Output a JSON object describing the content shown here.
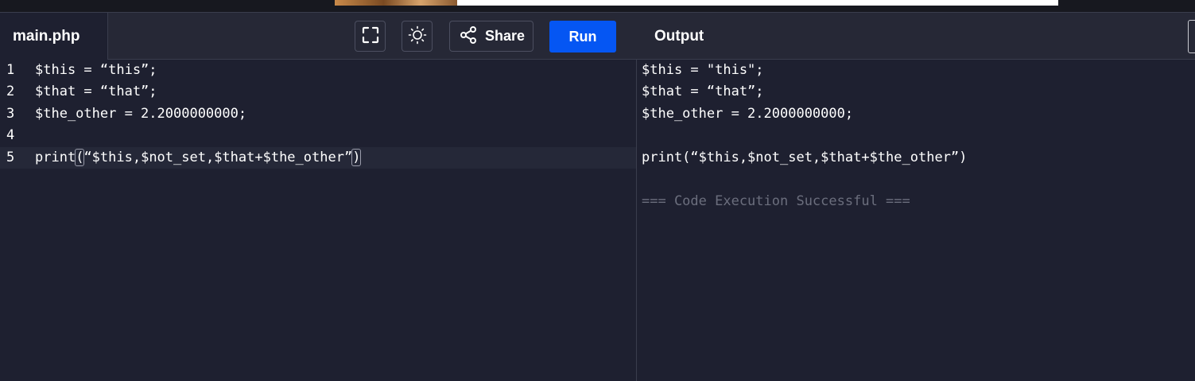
{
  "ad": {
    "image_icon": "advertisement-banner"
  },
  "toolbar": {
    "file_tab": "main.php",
    "fullscreen_icon": "fullscreen-icon",
    "theme_icon": "sun-icon",
    "share_label": "Share",
    "run_label": "Run",
    "output_title": "Output"
  },
  "editor": {
    "lines": [
      {
        "no": "1",
        "text": "$this = “this”;"
      },
      {
        "no": "2",
        "text": "$that = “that”;"
      },
      {
        "no": "3",
        "text": "$the_other = 2.2000000000;"
      },
      {
        "no": "4",
        "text": ""
      },
      {
        "no": "5",
        "pre": "print",
        "open": "(",
        "mid": "“$this,$not_set,$that+$the_other”",
        "close": ")"
      }
    ],
    "active_line": "5"
  },
  "output": {
    "lines": [
      "$this = \"this\";",
      "$that = “that”;",
      "$the_other = 2.2000000000;",
      "",
      "print(“$this,$not_set,$that+$the_other”)",
      "",
      "=== Code Execution Successful ==="
    ]
  },
  "colors": {
    "background": "#1e2030",
    "toolbar": "#262836",
    "run_button": "#0556f3",
    "status_text": "#6b6e7d"
  }
}
